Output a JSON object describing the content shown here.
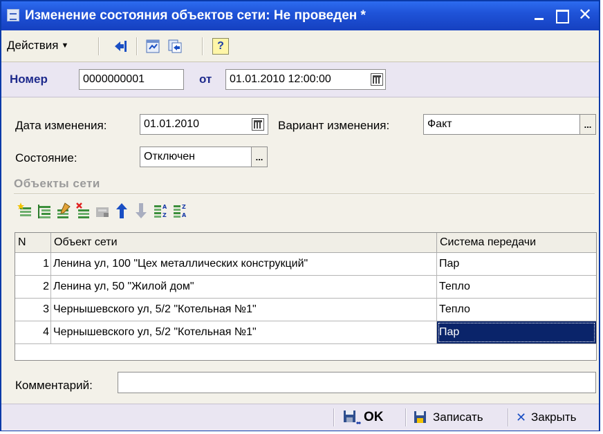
{
  "window": {
    "title": "Изменение состояния объектов сети: Не проведен *",
    "min_glyph": "_",
    "max_glyph": "",
    "close_glyph": "✕"
  },
  "toolbar": {
    "actions_label": "Действия",
    "help_label": "?"
  },
  "header": {
    "number_label": "Номер",
    "number_value": "0000000001",
    "date_from_label": "от",
    "date_value": "01.01.2010 12:00:00"
  },
  "form": {
    "change_date_label": "Дата изменения:",
    "change_date_value": "01.01.2010",
    "change_variant_label": "Вариант изменения:",
    "change_variant_value": "Факт",
    "state_label": "Состояние:",
    "state_value": "Отключен",
    "dots_label": "..."
  },
  "objects_group": {
    "title": "Объекты сети"
  },
  "table": {
    "columns": [
      "N",
      "Объект сети",
      "Система передачи"
    ],
    "rows": [
      {
        "n": "1",
        "object": "Ленина ул, 100 \"Цех металлических конструкций\"",
        "system": "Пар"
      },
      {
        "n": "2",
        "object": "Ленина ул, 50 \"Жилой дом\"",
        "system": "Тепло"
      },
      {
        "n": "3",
        "object": "Чернышевского ул, 5/2 \"Котельная №1\"",
        "system": "Тепло"
      },
      {
        "n": "4",
        "object": "Чернышевского ул, 5/2 \"Котельная №1\"",
        "system": "Пар"
      }
    ],
    "selected_row": 4
  },
  "comment": {
    "label": "Комментарий:",
    "value": ""
  },
  "footer": {
    "ok_label": "OK",
    "save_label": "Записать",
    "close_label": "Закрыть"
  },
  "colors": {
    "title_bar": "#1f53d8",
    "selection": "#0a246a",
    "header_strip": "#eae6f2",
    "window_bg": "#f3f1e9"
  }
}
